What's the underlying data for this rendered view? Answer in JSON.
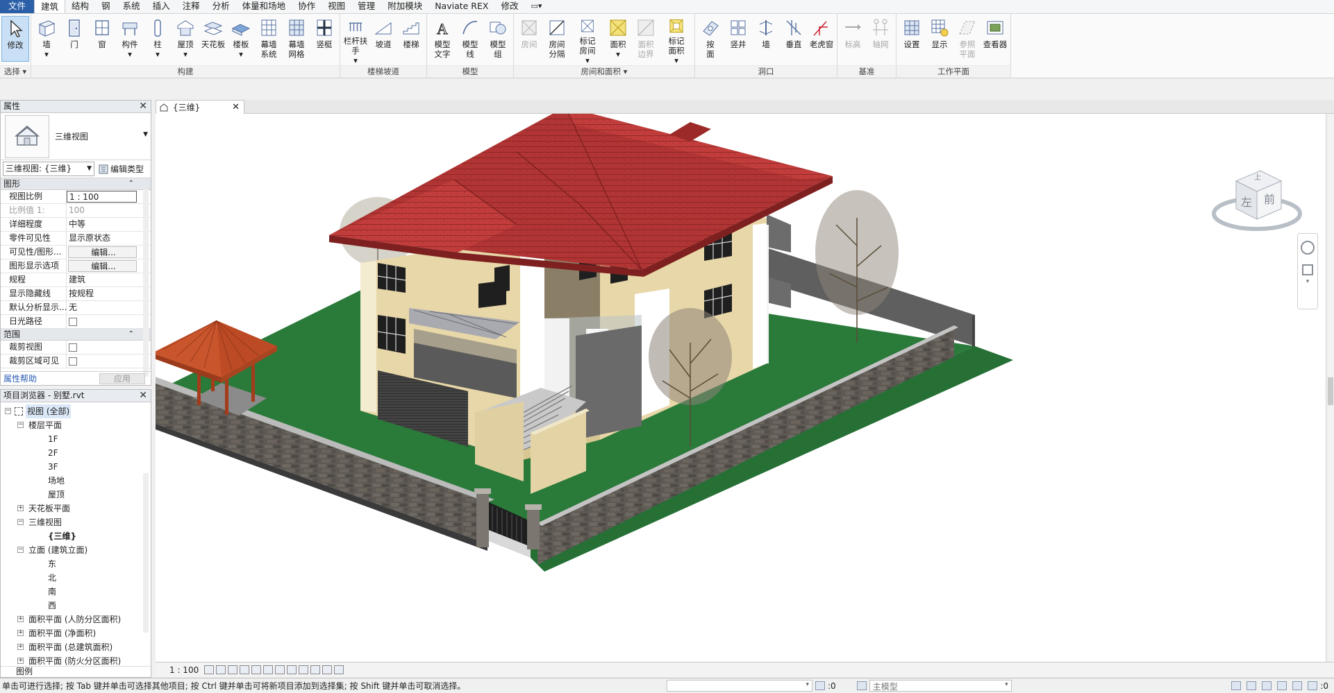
{
  "menu": {
    "tabs": [
      "文件",
      "建筑",
      "结构",
      "钢",
      "系统",
      "插入",
      "注释",
      "分析",
      "体量和场地",
      "协作",
      "视图",
      "管理",
      "附加模块",
      "Naviate REX",
      "修改"
    ],
    "active": "建筑",
    "extra": "▭▾"
  },
  "ribbon": {
    "groups": [
      {
        "title": "选择 ▾",
        "buttons": [
          {
            "label": "修改",
            "icon": "cursor-icon",
            "sel": true
          }
        ]
      },
      {
        "title": "构建",
        "buttons": [
          {
            "label": "墙\n▾",
            "icon": "wall-icon"
          },
          {
            "label": "门",
            "icon": "door-icon"
          },
          {
            "label": "窗",
            "icon": "window-icon"
          },
          {
            "label": "构件\n▾",
            "icon": "component-icon"
          },
          {
            "label": "柱\n▾",
            "icon": "column-icon"
          },
          {
            "label": "屋顶\n▾",
            "icon": "roof-icon"
          },
          {
            "label": "天花板",
            "icon": "ceiling-icon"
          },
          {
            "label": "楼板\n▾",
            "icon": "floor-icon"
          },
          {
            "label": "幕墙\n系统",
            "icon": "curtain-system-icon"
          },
          {
            "label": "幕墙\n网格",
            "icon": "curtain-grid-icon"
          },
          {
            "label": "竖梃",
            "icon": "mullion-icon"
          }
        ]
      },
      {
        "title": "楼梯坡道",
        "buttons": [
          {
            "label": "栏杆扶手\n▾",
            "icon": "railing-icon"
          },
          {
            "label": "坡道",
            "icon": "ramp-icon"
          },
          {
            "label": "楼梯",
            "icon": "stair-icon"
          }
        ]
      },
      {
        "title": "模型",
        "buttons": [
          {
            "label": "模型\n文字",
            "icon": "model-text-icon"
          },
          {
            "label": "模型\n线",
            "icon": "model-line-icon"
          },
          {
            "label": "模型\n组",
            "icon": "model-group-icon"
          }
        ]
      },
      {
        "title": "房间和面积 ▾",
        "buttons": [
          {
            "label": "房间",
            "icon": "room-icon",
            "dis": true
          },
          {
            "label": "房间\n分隔",
            "icon": "room-separator-icon"
          },
          {
            "label": "标记\n房间\n▾",
            "icon": "tag-room-icon"
          },
          {
            "label": "面积\n▾",
            "icon": "area-icon"
          },
          {
            "label": "面积\n边界",
            "icon": "area-boundary-icon",
            "dis": true
          },
          {
            "label": "标记\n面积\n▾",
            "icon": "tag-area-icon"
          }
        ]
      },
      {
        "title": "洞口",
        "buttons": [
          {
            "label": "按\n面",
            "icon": "by-face-icon"
          },
          {
            "label": "竖井",
            "icon": "shaft-icon"
          },
          {
            "label": "墙",
            "icon": "wall-opening-icon"
          },
          {
            "label": "垂直",
            "icon": "vertical-icon"
          },
          {
            "label": "老虎窗",
            "icon": "dormer-icon"
          }
        ]
      },
      {
        "title": "基准",
        "buttons": [
          {
            "label": "标高",
            "icon": "level-icon",
            "dis": true
          },
          {
            "label": "轴网",
            "icon": "grid-icon",
            "dis": true
          }
        ]
      },
      {
        "title": "工作平面",
        "buttons": [
          {
            "label": "设置",
            "icon": "set-icon"
          },
          {
            "label": "显示",
            "icon": "show-icon"
          },
          {
            "label": "参照\n平面",
            "icon": "ref-plane-icon",
            "dis": true
          },
          {
            "label": "查看器",
            "icon": "viewer-icon"
          }
        ]
      }
    ]
  },
  "properties": {
    "title": "属性",
    "type_name": "三维视图",
    "instance": "三维视图: {三维}",
    "edit_type": "编辑类型",
    "cat_graphics": "图形",
    "cat_extents": "范围",
    "rows": [
      {
        "k": "视图比例",
        "v": "1 : 100",
        "style": "box"
      },
      {
        "k": "比例值 1:",
        "v": "100",
        "style": "grey"
      },
      {
        "k": "详细程度",
        "v": "中等"
      },
      {
        "k": "零件可见性",
        "v": "显示原状态"
      },
      {
        "k": "可见性/图形...",
        "v": "编辑...",
        "style": "btn"
      },
      {
        "k": "图形显示选项",
        "v": "编辑...",
        "style": "btn"
      },
      {
        "k": "规程",
        "v": "建筑"
      },
      {
        "k": "显示隐藏线",
        "v": "按规程"
      },
      {
        "k": "默认分析显示...",
        "v": "无"
      },
      {
        "k": "日光路径",
        "v": "",
        "style": "chk"
      }
    ],
    "rows2": [
      {
        "k": "裁剪视图",
        "v": "",
        "style": "chk"
      },
      {
        "k": "裁剪区域可见",
        "v": "",
        "style": "chk"
      }
    ],
    "help": "属性帮助",
    "apply": "应用"
  },
  "browser": {
    "title": "项目浏览器 - 别墅.rvt",
    "nodes": [
      {
        "t": "视图 (全部)",
        "lvl": 0,
        "exp": "−",
        "sel": true
      },
      {
        "t": "楼层平面",
        "lvl": 1,
        "exp": "−"
      },
      {
        "t": "1F",
        "lvl": 2
      },
      {
        "t": "2F",
        "lvl": 2
      },
      {
        "t": "3F",
        "lvl": 2
      },
      {
        "t": "场地",
        "lvl": 2
      },
      {
        "t": "屋顶",
        "lvl": 2
      },
      {
        "t": "天花板平面",
        "lvl": 1,
        "exp": "+"
      },
      {
        "t": "三维视图",
        "lvl": 1,
        "exp": "−"
      },
      {
        "t": "{三维}",
        "lvl": 2,
        "bold": true
      },
      {
        "t": "立面 (建筑立面)",
        "lvl": 1,
        "exp": "−"
      },
      {
        "t": "东",
        "lvl": 2
      },
      {
        "t": "北",
        "lvl": 2
      },
      {
        "t": "南",
        "lvl": 2
      },
      {
        "t": "西",
        "lvl": 2
      },
      {
        "t": "面积平面 (人防分区面积)",
        "lvl": 1,
        "exp": "+"
      },
      {
        "t": "面积平面 (净面积)",
        "lvl": 1,
        "exp": "+"
      },
      {
        "t": "面积平面 (总建筑面积)",
        "lvl": 1,
        "exp": "+"
      },
      {
        "t": "面积平面 (防火分区面积)",
        "lvl": 1,
        "exp": "+"
      }
    ],
    "legend": "图例"
  },
  "view": {
    "tab": "{三维}",
    "scale": "1 : 100",
    "viewcube_left": "左",
    "viewcube_front": "前",
    "viewcube_top": "上"
  },
  "status": {
    "text": "单击可进行选择; 按 Tab 键并单击可选择其他项目; 按 Ctrl 键并单击可将新项目添加到选择集; 按 Shift 键并单击可取消选择。",
    "zero1": ":0",
    "model": "主模型",
    "zero2": ":0"
  },
  "colors": {
    "roof": "#b13534",
    "wall": "#e8d7a8",
    "grass": "#2a7a3a",
    "stone": "#5a5550",
    "pavilion": "#c8522b",
    "accent": "#2b5fa8"
  }
}
